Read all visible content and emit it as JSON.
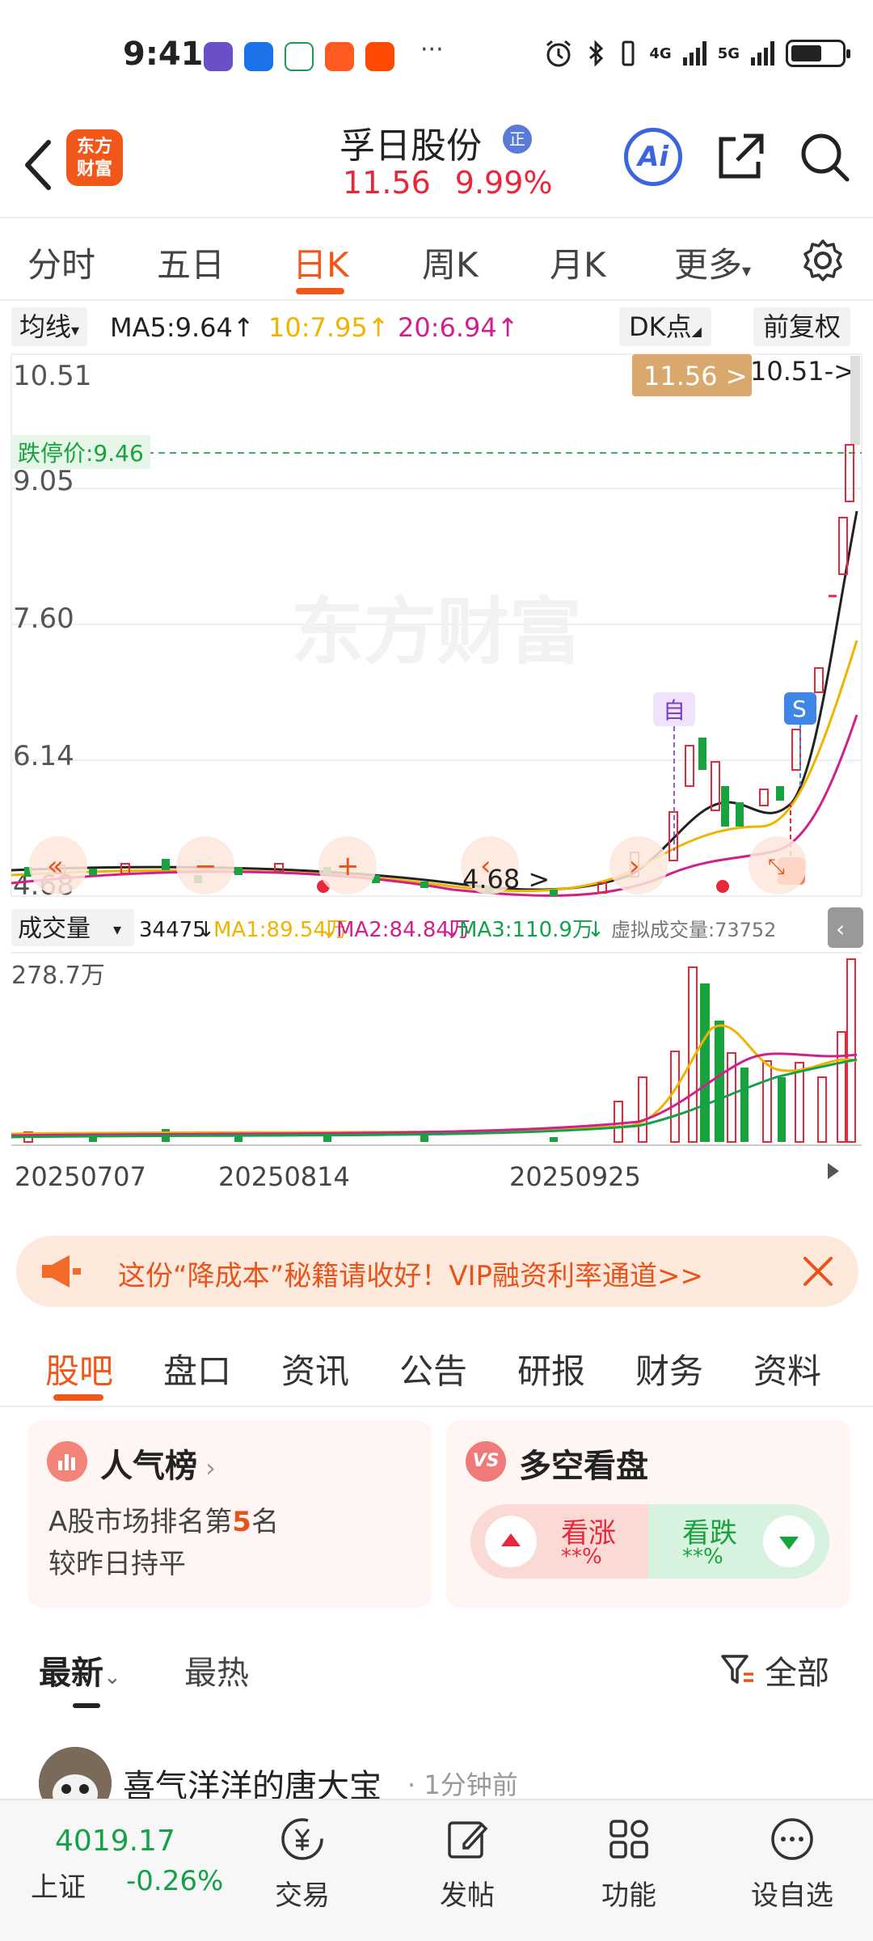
{
  "status_bar": {
    "time": "9:41",
    "more": "···",
    "net1": "4G",
    "net2": "5G"
  },
  "header": {
    "stock_name": "孚日股份",
    "badge": "正",
    "price": "11.56",
    "change_pct": "9.99%",
    "logo_line1": "东方",
    "logo_line2": "财富",
    "ai_label": "Ai"
  },
  "period_tabs": [
    "分时",
    "五日",
    "日K",
    "周K",
    "月K",
    "更多"
  ],
  "period_active": "日K",
  "ma_bar": {
    "selector": "均线",
    "ma5": "MA5:9.64",
    "ma10": "10:7.95",
    "ma20": "20:6.94",
    "dk_button": "DK点",
    "adjust_button": "前复权"
  },
  "price_chart": {
    "y_labels": [
      "10.51",
      "9.05",
      "7.60",
      "6.14",
      "4.68"
    ],
    "limit_down_label": "跌停价:9.46",
    "current_price_tag": "11.56 >",
    "high_label": "10.51->",
    "low_label": "4.68 >",
    "watermark": "东方财富",
    "marker_zi": "自",
    "marker_s": "S"
  },
  "volume_bar": {
    "selector": "成交量",
    "vol": "34475",
    "ma1": "MA1:89.54万",
    "ma2": "MA2:84.84万",
    "ma3": "MA3:110.9万",
    "virtual": "虚拟成交量:73752",
    "max_label": "278.7万"
  },
  "x_dates": [
    "20250707",
    "20250814",
    "20250925"
  ],
  "colors": {
    "up": "#e8283a",
    "down": "#18a33e",
    "ma5": "#222222",
    "ma10": "#f0b400",
    "ma20": "#d0208c",
    "accent": "#f2571a"
  },
  "chart_data": {
    "type": "candlestick",
    "x_labels": [
      "20250707",
      "20250814",
      "20250925"
    ],
    "y_ticks": [
      10.51,
      9.05,
      7.6,
      6.14,
      4.68
    ],
    "ylim": [
      4.68,
      10.51
    ],
    "last_close": 11.56,
    "limit_down": 9.46,
    "series": [
      {
        "name": "MA5",
        "last": 9.64
      },
      {
        "name": "MA10",
        "last": 7.95
      },
      {
        "name": "MA20",
        "last": 6.94
      }
    ],
    "volume_ylim_max": "278.7万"
  },
  "promo": {
    "text": "这份“降成本”秘籍请收好！VIP融资利率通道>>"
  },
  "section_tabs": [
    "股吧",
    "盘口",
    "资讯",
    "公告",
    "研报",
    "财务",
    "资料"
  ],
  "section_active": "股吧",
  "popularity_card": {
    "title": "人气榜",
    "line1_prefix": "A股市场排名第",
    "rank": "5",
    "line1_suffix": "名",
    "line2": "较昨日持平"
  },
  "sentiment_card": {
    "title": "多空看盘",
    "vs": "VS",
    "bull": "看涨",
    "bull_pct": "**%",
    "bear": "看跌",
    "bear_pct": "**%"
  },
  "feed": {
    "sort_latest": "最新",
    "sort_hot": "最热",
    "filter": "全部"
  },
  "post": {
    "user": "喜气洋洋的唐大宝",
    "time": "· 1分钟前"
  },
  "bottom_nav": {
    "index_value": "4019.17",
    "index_name": "上证",
    "index_change": "-0.26%",
    "items": [
      "交易",
      "发帖",
      "功能",
      "设自选"
    ]
  }
}
